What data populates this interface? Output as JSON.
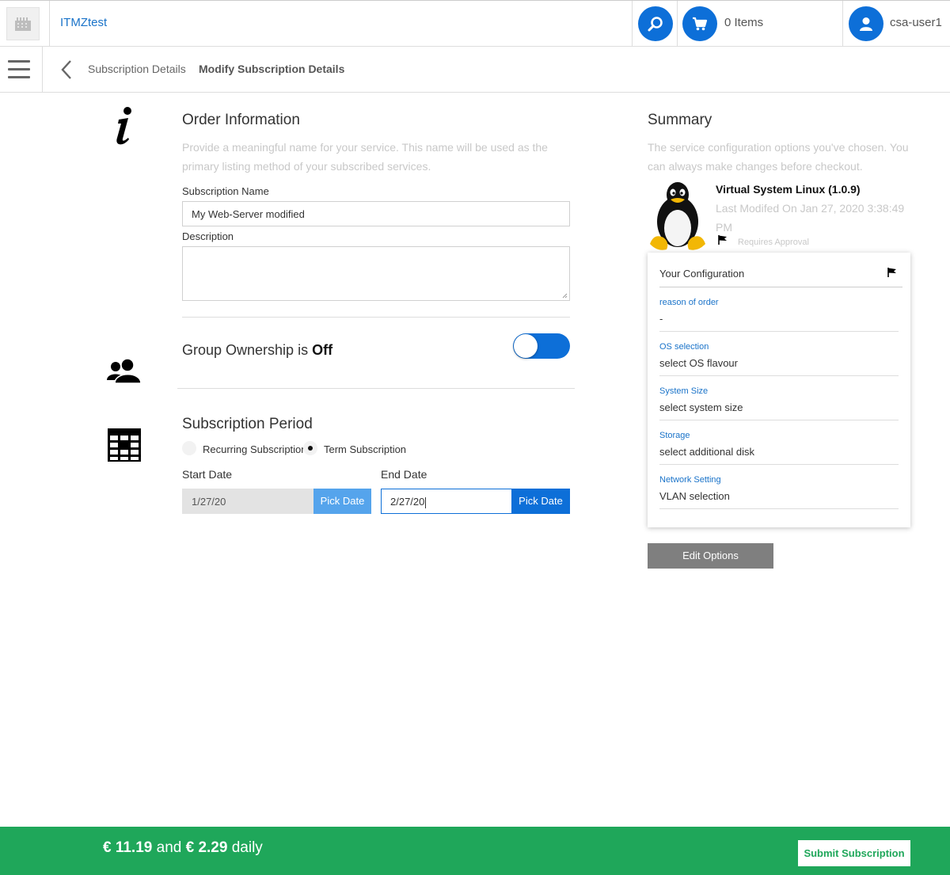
{
  "header": {
    "tenant_name": "ITMZtest",
    "cart_label": "0 Items",
    "user_name": "csa-user1"
  },
  "breadcrumb": {
    "previous": "Subscription Details",
    "current": "Modify Subscription Details"
  },
  "order_info": {
    "title": "Order Information",
    "help_line1": "Provide a meaningful name for your service. This name will be used as the",
    "help_line2": "primary listing method of your subscribed services.",
    "name_label": "Subscription Name",
    "name_value": "My Web-Server modified",
    "description_label": "Description",
    "description_value": ""
  },
  "group_ownership": {
    "label": "Group Ownership is",
    "state": "Off"
  },
  "subscription_period": {
    "title": "Subscription Period",
    "option_recurring": "Recurring Subscription",
    "option_term": "Term Subscription",
    "start_label": "Start Date",
    "start_value": "1/27/20",
    "end_label": "End Date",
    "end_value": "2/27/20",
    "pick_date_label": "Pick Date"
  },
  "summary": {
    "title": "Summary",
    "help_line1": "The service configuration options you've chosen. You",
    "help_line2": "can always make changes before checkout.",
    "product_name": "Virtual System Linux (1.0.9)",
    "last_modified": "Last Modifed On Jan 27, 2020 3:38:49 PM",
    "requires_approval": "Requires Approval",
    "config_title": "Your Configuration",
    "config": [
      {
        "key": "reason of order",
        "value": "-"
      },
      {
        "key": "OS selection",
        "value": "select OS flavour"
      },
      {
        "key": "System Size",
        "value": "select system size"
      },
      {
        "key": "Storage",
        "value": "select additional disk"
      },
      {
        "key": "Network Setting",
        "value": "VLAN selection"
      }
    ],
    "edit_options_label": "Edit Options"
  },
  "footer": {
    "price_once": "€ 11.19",
    "price_and": "and",
    "price_daily": "€ 2.29",
    "price_daily_suffix": "daily",
    "submit_label": "Submit Subscription"
  },
  "colors": {
    "primary_blue": "#0d6fd8",
    "footer_green": "#1fa75a",
    "link_blue": "#1a73c9"
  }
}
